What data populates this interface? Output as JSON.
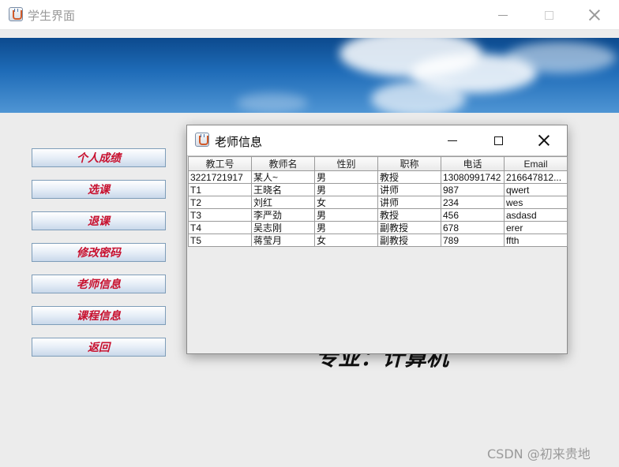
{
  "window": {
    "title": "学生界面"
  },
  "menu": [
    "个人成绩",
    "选课",
    "退课",
    "修改密码",
    "老师信息",
    "课程信息",
    "返回"
  ],
  "major_label": "专业：计算机",
  "watermark": "CSDN @初来贵地",
  "dialog": {
    "title": "老师信息",
    "columns": [
      "教工号",
      "教师名",
      "性别",
      "职称",
      "电话",
      "Email"
    ],
    "rows": [
      [
        "3221721917",
        "某人~",
        "男",
        "教授",
        "13080991742",
        "216647812..."
      ],
      [
        "T1",
        "王晓名",
        "男",
        "讲师",
        "987",
        "qwert"
      ],
      [
        "T2",
        "刘红",
        "女",
        "讲师",
        "234",
        "wes"
      ],
      [
        "T3",
        "李严劲",
        "男",
        "教授",
        "456",
        "asdasd"
      ],
      [
        "T4",
        "吴志刚",
        "男",
        "副教授",
        "678",
        "erer"
      ],
      [
        "T5",
        "蒋莹月",
        "女",
        "副教授",
        "789",
        "ffth"
      ]
    ]
  }
}
